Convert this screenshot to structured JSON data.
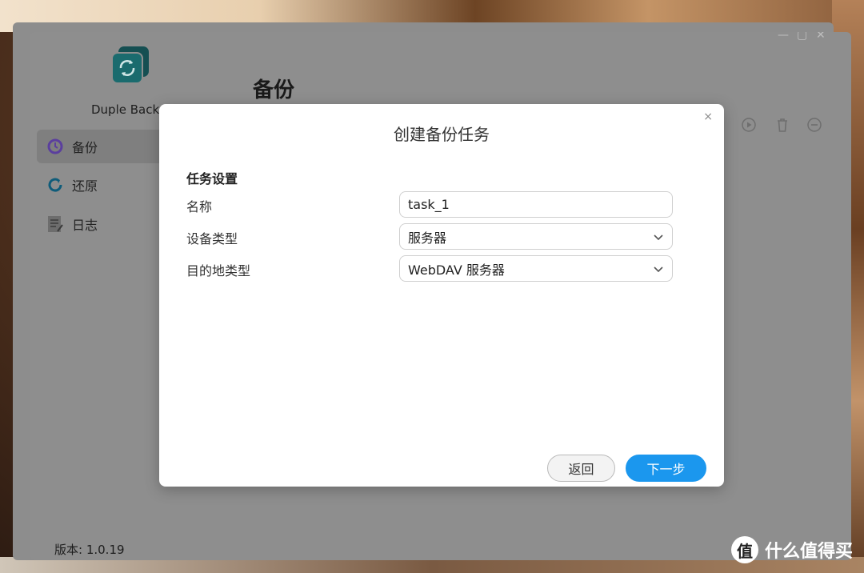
{
  "app": {
    "name": "Duple Backup",
    "page_title": "备份",
    "version": "版本: 1.0.19"
  },
  "sidebar": {
    "items": [
      {
        "label": "备份",
        "icon": "clock-icon",
        "active": true
      },
      {
        "label": "还原",
        "icon": "restore-icon",
        "active": false
      },
      {
        "label": "日志",
        "icon": "log-icon",
        "active": false
      }
    ]
  },
  "toolbar": {
    "icons": [
      "play-icon",
      "trash-icon",
      "minus-circle-icon"
    ]
  },
  "dialog": {
    "title": "创建备份任务",
    "close_glyph": "×",
    "section_title": "任务设置",
    "fields": {
      "name": {
        "label": "名称",
        "value": "task_1"
      },
      "device_type": {
        "label": "设备类型",
        "value": "服务器"
      },
      "destination_type": {
        "label": "目的地类型",
        "value": "WebDAV 服务器"
      }
    },
    "buttons": {
      "back": "返回",
      "next": "下一步"
    }
  },
  "watermark": {
    "glyph": "值",
    "text": "什么值得买"
  },
  "colors": {
    "accent": "#1b97ee",
    "logo": "#1a6b6e"
  }
}
